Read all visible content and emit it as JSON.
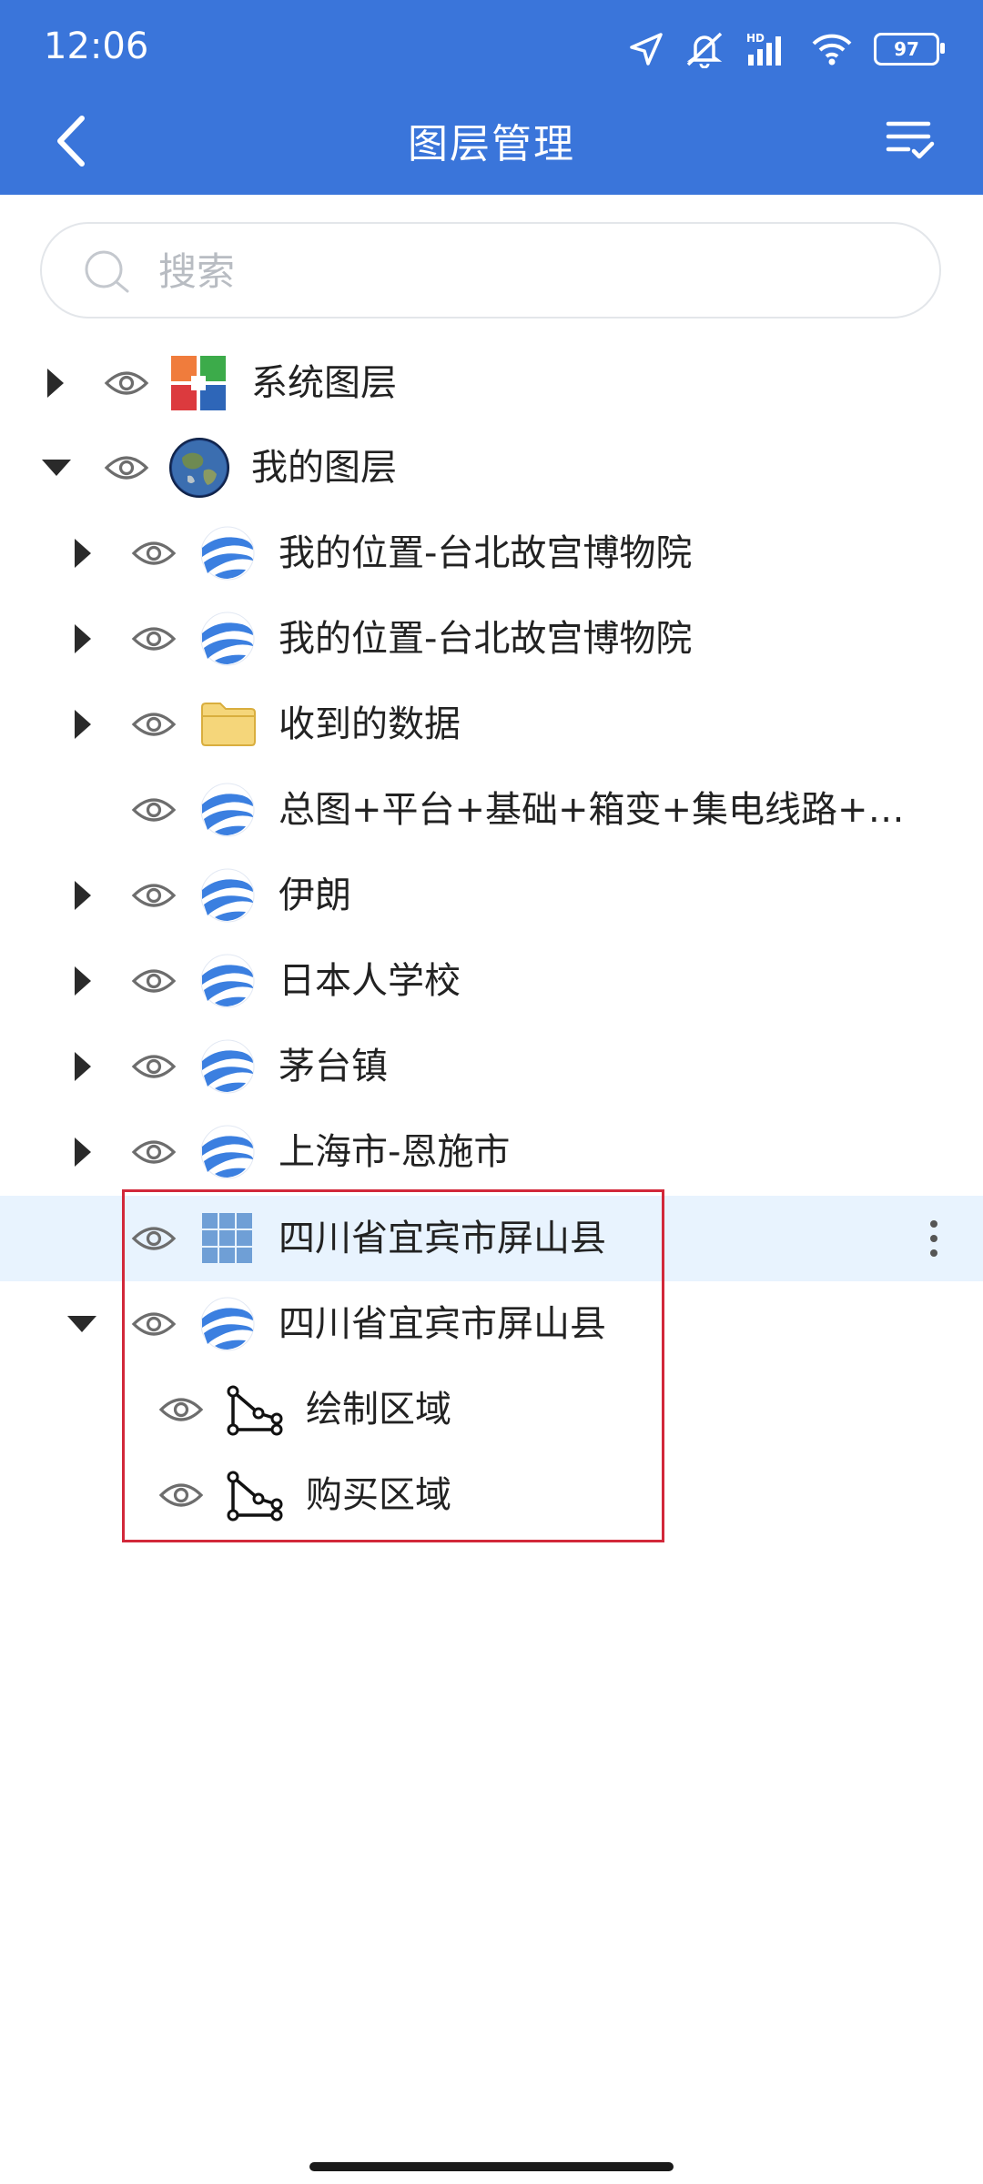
{
  "status_bar": {
    "time": "12:06",
    "battery": "97",
    "hd_label": "HD"
  },
  "header": {
    "title": "图层管理"
  },
  "search": {
    "placeholder": "搜索"
  },
  "tree": {
    "system_layer": "系统图层",
    "my_layers": "我的图层",
    "items": [
      {
        "label": "我的位置-台北故宫博物院"
      },
      {
        "label": "我的位置-台北故宫博物院"
      },
      {
        "label": "收到的数据"
      },
      {
        "label": "总图+平台+基础+箱变+集电线路+…"
      },
      {
        "label": "伊朗"
      },
      {
        "label": "日本人学校"
      },
      {
        "label": "茅台镇"
      },
      {
        "label": "上海市-恩施市"
      },
      {
        "label": "四川省宜宾市屏山县"
      },
      {
        "label": "四川省宜宾市屏山县"
      }
    ],
    "sub_items": [
      {
        "label": "绘制区域"
      },
      {
        "label": "购买区域"
      }
    ]
  },
  "colors": {
    "accent": "#3a75da",
    "selected_row": "#e8f3fe",
    "highlight_border": "#d2283a"
  }
}
